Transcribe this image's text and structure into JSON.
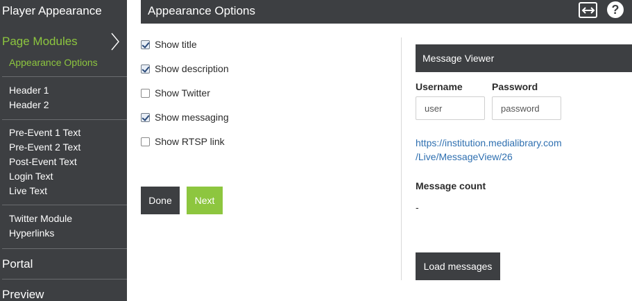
{
  "sidebar": {
    "top_title": "Player Appearance",
    "section_heading": "Page Modules",
    "active_item": "Appearance Options",
    "group1": [
      "Header 1",
      "Header 2"
    ],
    "group2": [
      "Pre-Event 1 Text",
      "Pre-Event 2 Text",
      "Post-Event Text",
      "Login Text",
      "Live Text"
    ],
    "group3": [
      "Twitter Module",
      "Hyperlinks"
    ],
    "portal": "Portal",
    "preview": "Preview",
    "accent_color": "#8dc63f"
  },
  "header": {
    "title": "Appearance Options",
    "expand_icon": "expand-horizontal-icon",
    "help_icon": "help-icon",
    "help_glyph": "?"
  },
  "options": [
    {
      "label": "Show title",
      "checked": true
    },
    {
      "label": "Show description",
      "checked": true
    },
    {
      "label": "Show Twitter",
      "checked": false
    },
    {
      "label": "Show messaging",
      "checked": true
    },
    {
      "label": "Show RTSP link",
      "checked": false
    }
  ],
  "actions": {
    "done": "Done",
    "next": "Next"
  },
  "message_viewer": {
    "title": "Message Viewer",
    "username_label": "Username",
    "username_placeholder": "user",
    "password_label": "Password",
    "password_placeholder": "password",
    "link_line1": "https://institution.medialibrary.com",
    "link_line2": "/Live/MessageView/26",
    "count_label": "Message count",
    "count_value": "-",
    "load_button": "Load messages"
  }
}
